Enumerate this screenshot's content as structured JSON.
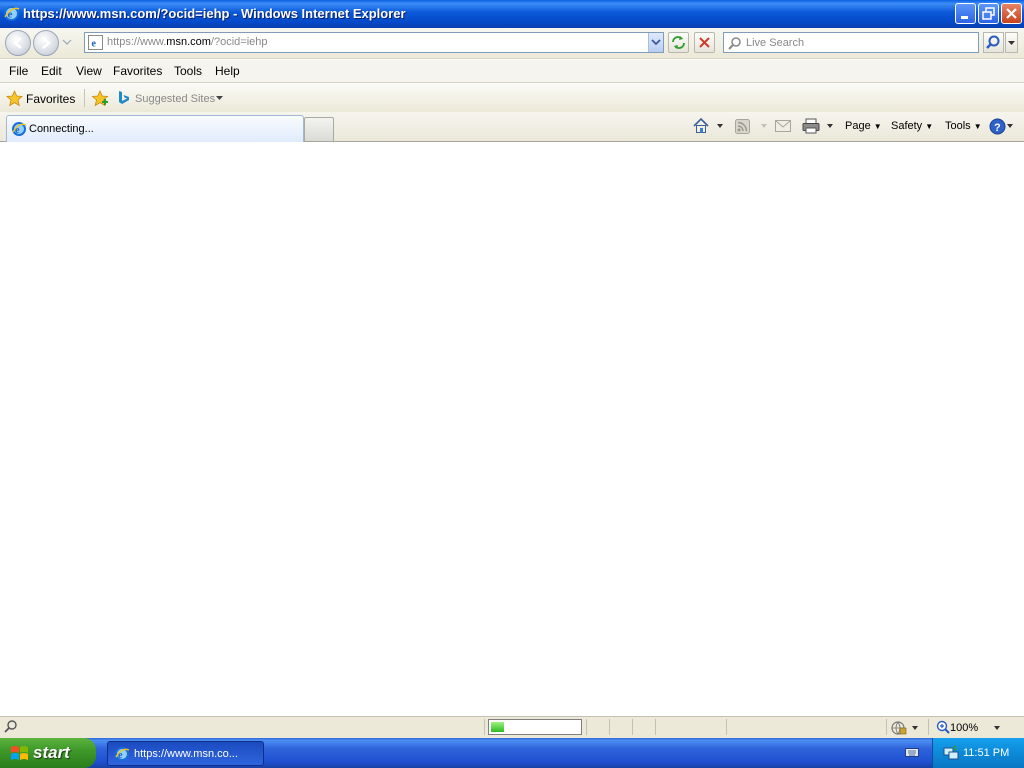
{
  "window": {
    "title": "https://www.msn.com/?ocid=iehp - Windows Internet Explorer"
  },
  "address_bar": {
    "prefix": "https://www.",
    "domain": "msn.com",
    "suffix": "/?ocid=iehp"
  },
  "search": {
    "placeholder": "Live Search"
  },
  "menu": {
    "items": [
      "File",
      "Edit",
      "View",
      "Favorites",
      "Tools",
      "Help"
    ]
  },
  "favorites_bar": {
    "favorites_label": "Favorites",
    "suggested_label": "Suggested Sites"
  },
  "tabs": {
    "active_label": "Connecting..."
  },
  "command_bar": {
    "page_label": "Page",
    "safety_label": "Safety",
    "tools_label": "Tools"
  },
  "status_bar": {
    "progress": 0.15,
    "zoom": "100%"
  },
  "taskbar": {
    "start_label": "start",
    "task_label": "https://www.msn.co...",
    "clock": "11:51 PM"
  },
  "colors": {
    "titlebar": "#0a58d8",
    "taskbar": "#245edb",
    "start_green": "#3f9a2a"
  }
}
